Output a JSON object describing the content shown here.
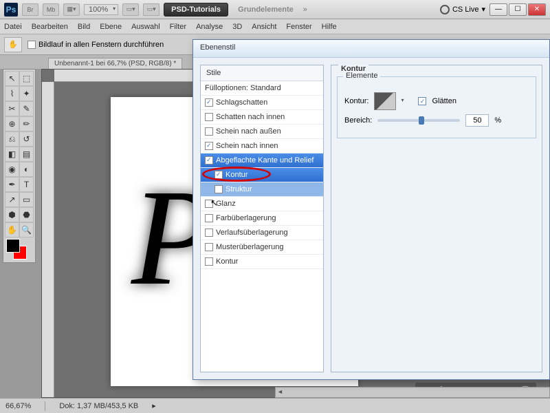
{
  "top": {
    "br": "Br",
    "mb": "Mb",
    "zoom": "100%",
    "essentials": "PSD-Tutorials",
    "grundel": "Grundelemente",
    "chev": "»",
    "cslive": "CS Live"
  },
  "menu": [
    "Datei",
    "Bearbeiten",
    "Bild",
    "Ebene",
    "Auswahl",
    "Filter",
    "Analyse",
    "3D",
    "Ansicht",
    "Fenster",
    "Hilfe"
  ],
  "options": {
    "scroll_all": "Bildlauf in allen Fenstern durchführen"
  },
  "doc_tab": "Unbenannt-1 bei 66,7% (PSD, RGB/8) *",
  "status": {
    "zoom": "66,67%",
    "dok": "Dok: 1,37 MB/453,5 KB"
  },
  "dialog": {
    "title": "Ebenenstil",
    "styles_header": "Stile",
    "fill_options": "Fülloptionen: Standard",
    "items": [
      {
        "label": "Schlagschatten",
        "checked": true
      },
      {
        "label": "Schatten nach innen",
        "checked": false
      },
      {
        "label": "Schein nach außen",
        "checked": false
      },
      {
        "label": "Schein nach innen",
        "checked": true
      },
      {
        "label": "Abgeflachte Kante und Relief",
        "checked": true,
        "selected": false,
        "blue": true
      },
      {
        "label": "Kontur",
        "checked": true,
        "selected": true,
        "sub": true,
        "red": true
      },
      {
        "label": "Struktur",
        "checked": false,
        "sub": true,
        "struct": true
      },
      {
        "label": "Glanz",
        "checked": false,
        "cursor": true
      },
      {
        "label": "Farbüberlagerung",
        "checked": false
      },
      {
        "label": "Verlaufsüberlagerung",
        "checked": false
      },
      {
        "label": "Musterüberlagerung",
        "checked": false
      },
      {
        "label": "Kontur",
        "checked": false
      }
    ],
    "right": {
      "panel_title": "Kontur",
      "group": "Elemente",
      "kontur_label": "Kontur:",
      "glatten": "Glätten",
      "bereich": "Bereich:",
      "bereich_val": "50",
      "pct": "%"
    }
  },
  "canvas_letter": "P"
}
